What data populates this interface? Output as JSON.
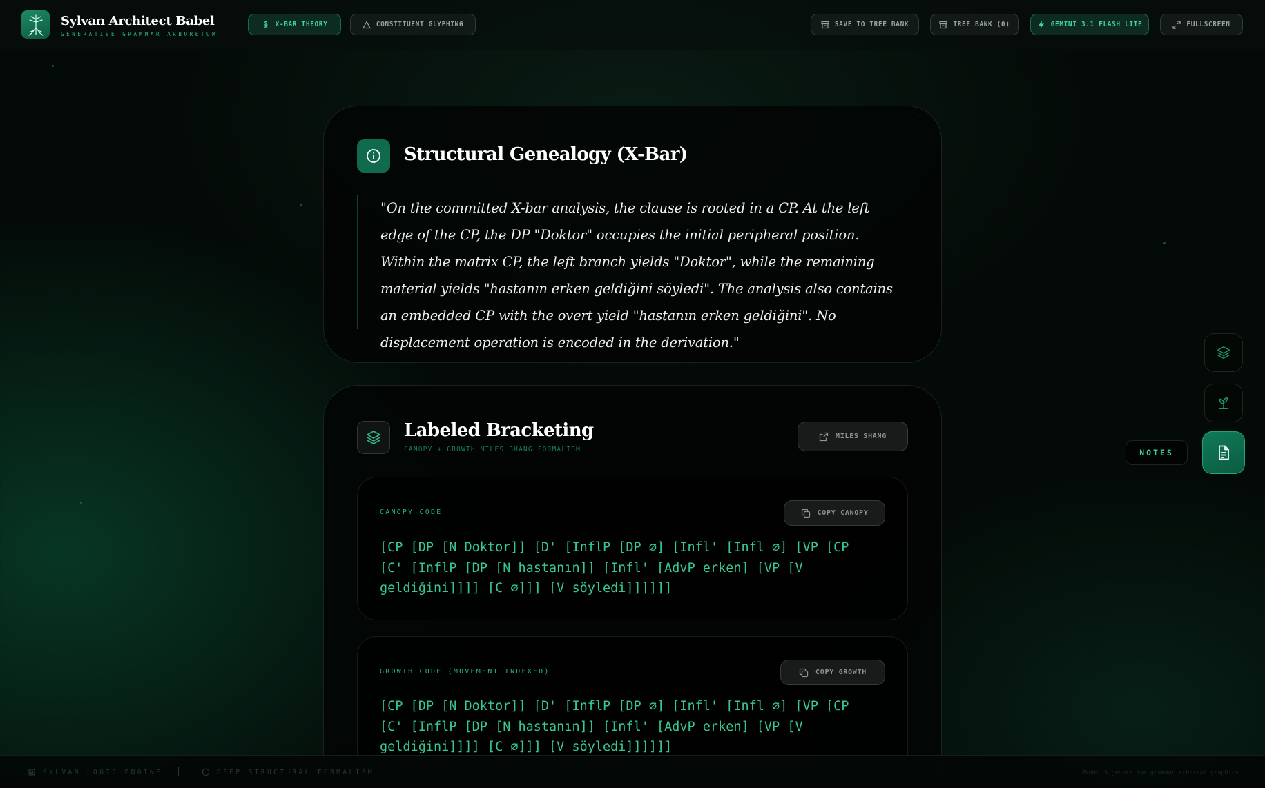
{
  "header": {
    "app_title": "Sylvan Architect Babel",
    "app_subtitle": "GENERATIVE GRAMMAR ARBORETUM",
    "tabs": [
      {
        "label": "X-BAR THEORY",
        "icon": "person-tree-icon",
        "active": true
      },
      {
        "label": "CONSTITUENT GLYPHING",
        "icon": "triangle-icon",
        "active": false
      }
    ],
    "actions": {
      "save": "SAVE TO TREE BANK",
      "bank": "TREE BANK (0)",
      "model": "GEMINI 3.1 FLASH LITE",
      "fullscreen": "FULLSCREEN"
    }
  },
  "genealogy": {
    "title": "Structural Genealogy (X-Bar)",
    "text": "\"On the committed X-bar analysis, the clause is rooted in a CP. At the left edge of the CP, the DP \"Doktor\" occupies the initial peripheral position. Within the matrix CP, the left branch yields \"Doktor\", while the remaining material yields \"hastanın erken geldiğini söyledi\". The analysis also contains an embedded CP with the overt yield \"hastanın erken geldiğini\". No displacement operation is encoded in the derivation.\""
  },
  "bracketing": {
    "title": "Labeled Bracketing",
    "subtitle": "CANOPY + GROWTH MILES SHANG FORMALISM",
    "link_button": "MILES SHANG",
    "canopy": {
      "label": "CANOPY CODE",
      "copy_button": "COPY CANOPY",
      "code": "[CP [DP [N Doktor]] [D' [InflP [DP ∅] [Infl' [Infl ∅] [VP [CP [C' [InflP [DP [N hastanın]] [Infl' [AdvP erken] [VP [V geldiğini]]]] [C ∅]]] [V söyledi]]]]]]"
    },
    "growth": {
      "label": "GROWTH CODE (MOVEMENT INDEXED)",
      "copy_button": "COPY GROWTH",
      "code": "[CP [DP [N Doktor]] [D' [InflP [DP ∅] [Infl' [Infl ∅] [VP [CP [C' [InflP [DP [N hastanın]] [Infl' [AdvP erken] [VP [V geldiğini]]]] [C ∅]]] [V söyledi]]]]]]"
    }
  },
  "rail": {
    "notes_label": "NOTES",
    "buttons": [
      "layers-icon",
      "sprout-icon",
      "document-icon"
    ]
  },
  "footer": {
    "left": "SYLVAN LOGIC ENGINE",
    "middle": "DEEP STRUCTURAL FORMALISM",
    "right": "Model & generative grammar arboreal graphics"
  },
  "colors": {
    "accent": "#2fb589",
    "code": "#36c890",
    "background": "#040a07"
  }
}
